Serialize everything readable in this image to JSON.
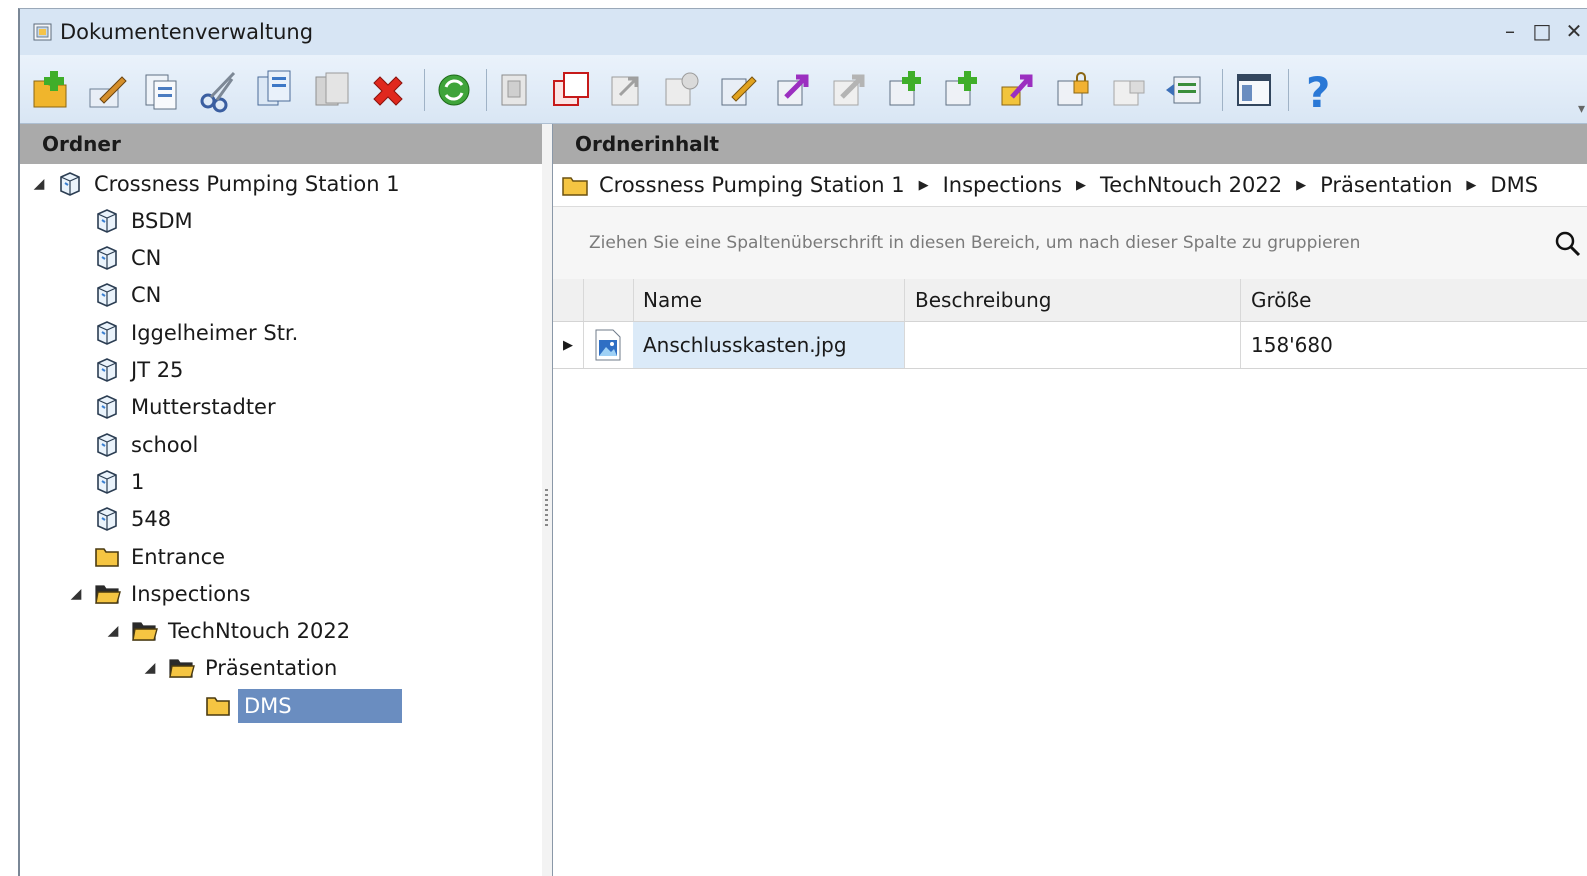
{
  "window": {
    "title": "Dokumentenverwaltung"
  },
  "toolbar_icons": [
    "new-document-icon",
    "edit-document-icon",
    "properties-icon",
    "cut-icon",
    "copy-icon",
    "paste-icon",
    "delete-icon",
    "refresh-icon",
    "document-template-icon",
    "document-copy-icon",
    "document-move-icon",
    "document-remove-icon",
    "document-edit-icon",
    "document-export-icon",
    "document-export-disabled-icon",
    "document-add-icon",
    "document-add-version-icon",
    "document-checkout-icon",
    "document-lock-icon",
    "document-unlock-icon",
    "scan-icon",
    "window-icon",
    "help-icon"
  ],
  "left": {
    "header": "Ordner",
    "tree": [
      {
        "label": "Crossness Pumping Station 1",
        "level": 0,
        "type": "project",
        "expanded": true
      },
      {
        "label": "BSDM",
        "level": 1,
        "type": "project"
      },
      {
        "label": "CN",
        "level": 1,
        "type": "project"
      },
      {
        "label": "CN",
        "level": 1,
        "type": "project"
      },
      {
        "label": "Iggelheimer Str.",
        "level": 1,
        "type": "project"
      },
      {
        "label": "JT 25",
        "level": 1,
        "type": "project"
      },
      {
        "label": "Mutterstadter",
        "level": 1,
        "type": "project"
      },
      {
        "label": "school",
        "level": 1,
        "type": "project"
      },
      {
        "label": "1",
        "level": 1,
        "type": "project"
      },
      {
        "label": "548",
        "level": 1,
        "type": "project"
      },
      {
        "label": "Entrance",
        "level": 1,
        "type": "folder"
      },
      {
        "label": "Inspections",
        "level": 1,
        "type": "folder-open",
        "expanded": true
      },
      {
        "label": "TechNtouch 2022",
        "level": 2,
        "type": "folder-open",
        "expanded": true
      },
      {
        "label": "Präsentation",
        "level": 3,
        "type": "folder-open",
        "expanded": true
      },
      {
        "label": "DMS",
        "level": 4,
        "type": "folder",
        "selected": true
      }
    ]
  },
  "right": {
    "header": "Ordnerinhalt",
    "breadcrumb": [
      "Crossness Pumping Station 1",
      "Inspections",
      "TechNtouch 2022",
      "Präsentation",
      "DMS"
    ],
    "group_hint": "Ziehen Sie eine Spaltenüberschrift in diesen Bereich, um nach dieser Spalte zu gruppieren",
    "columns": [
      "Name",
      "Beschreibung",
      "Größe"
    ],
    "rows": [
      {
        "name": "Anschlusskasten.jpg",
        "description": "",
        "size": "158'680"
      }
    ]
  }
}
